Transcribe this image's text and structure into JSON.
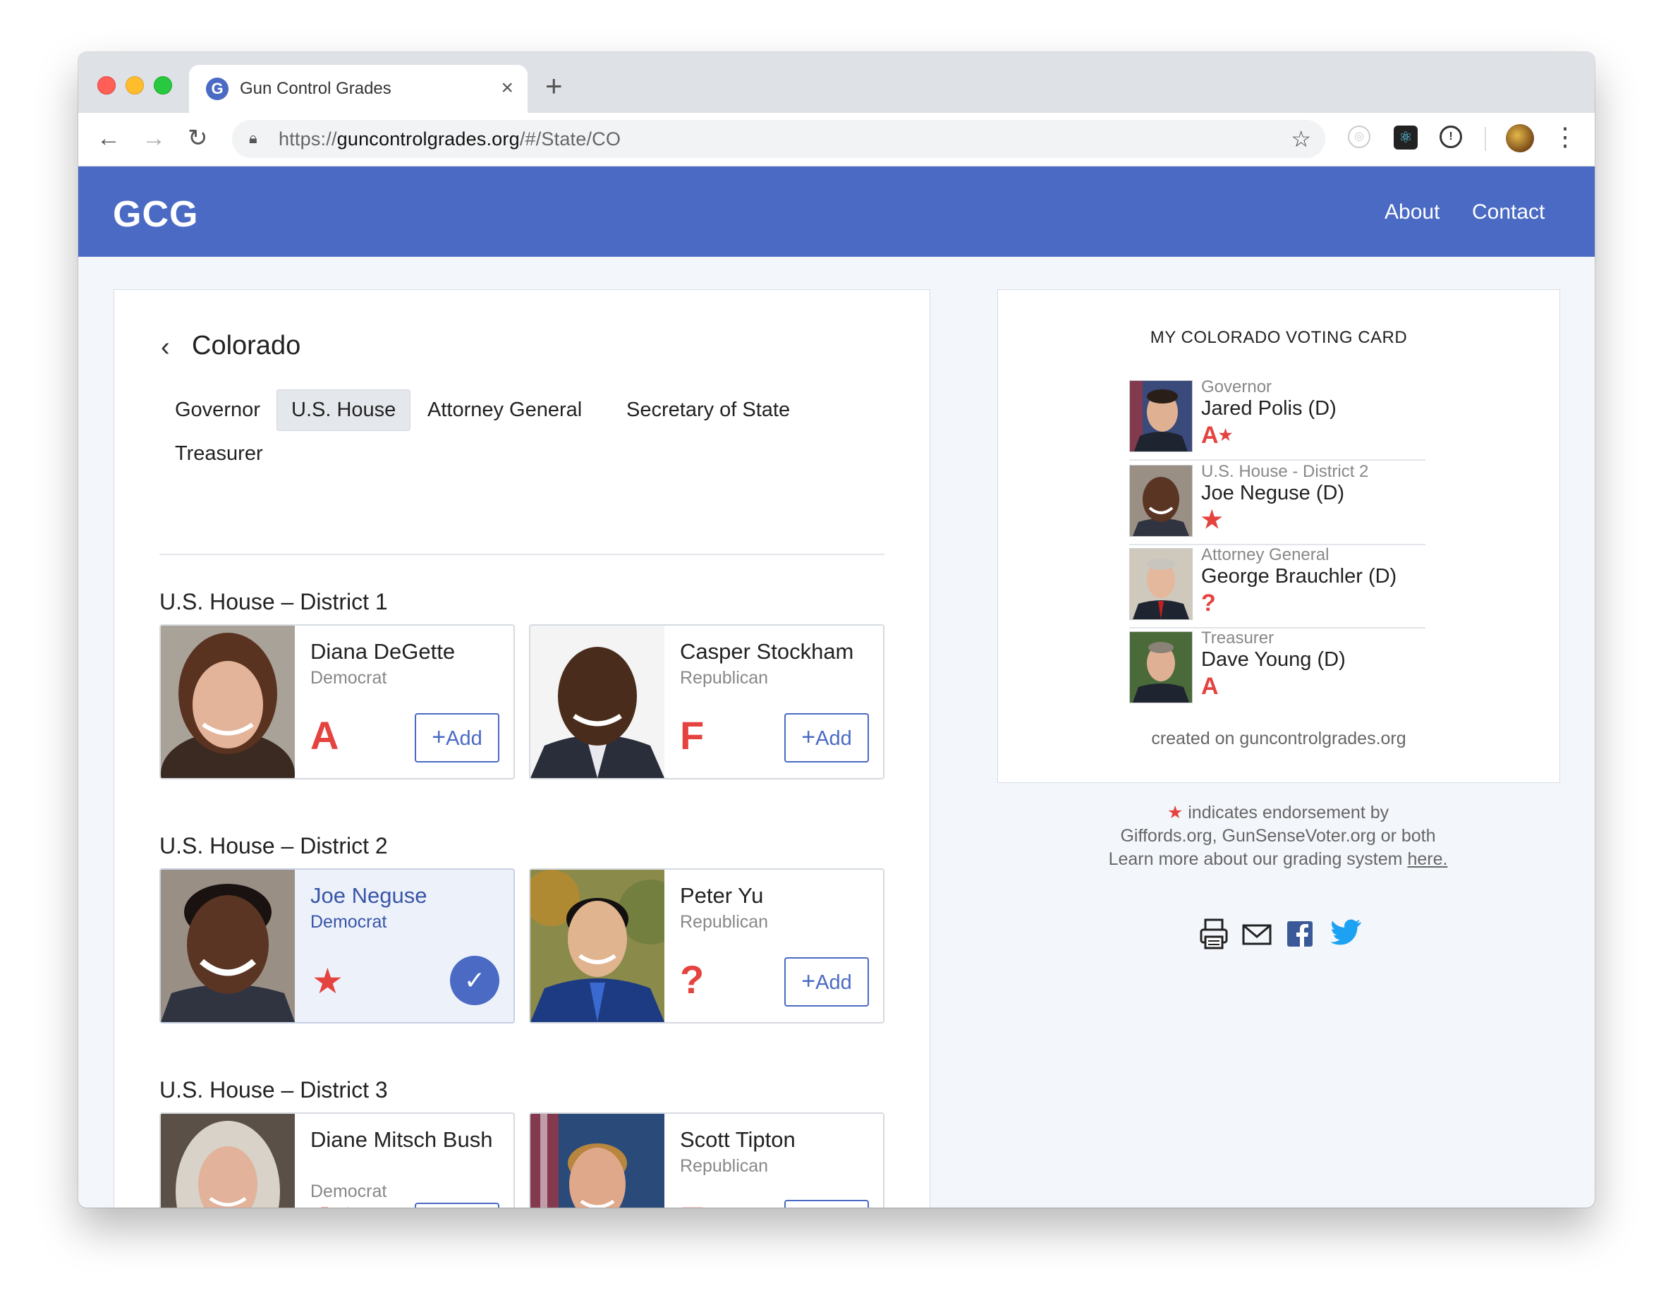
{
  "browser": {
    "tab_title": "Gun Control Grades",
    "tab_favicon": "G",
    "url_scheme": "https://",
    "url_host": "guncontrolgrades.org",
    "url_path": "/#/State/CO"
  },
  "site": {
    "logo": "GCG",
    "nav": {
      "about": "About",
      "contact": "Contact"
    },
    "brand_color": "#4a6ac4",
    "grade_color": "#e5433f"
  },
  "main": {
    "state": "Colorado",
    "office_tabs": [
      "Governor",
      "U.S. House",
      "Attorney General",
      "Secretary of State",
      "Treasurer"
    ],
    "active_tab": "U.S. House",
    "add_label": "Add",
    "districts": [
      {
        "title": "U.S. House – District 1",
        "candidates": [
          {
            "name": "Diana DeGette",
            "party": "Democrat",
            "grade": "A",
            "endorsed": false,
            "selected": false
          },
          {
            "name": "Casper Stockham",
            "party": "Republican",
            "grade": "F",
            "endorsed": false,
            "selected": false
          }
        ]
      },
      {
        "title": "U.S. House – District 2",
        "candidates": [
          {
            "name": "Joe Neguse",
            "party": "Democrat",
            "grade": "★",
            "endorsed": true,
            "selected": true
          },
          {
            "name": "Peter Yu",
            "party": "Republican",
            "grade": "?",
            "endorsed": false,
            "selected": false
          }
        ]
      },
      {
        "title": "U.S. House – District 3",
        "candidates": [
          {
            "name": "Diane Mitsch Bush",
            "party": "Democrat",
            "grade": "A",
            "endorsed": true,
            "selected": false
          },
          {
            "name": "Scott Tipton",
            "party": "Republican",
            "grade": "F",
            "endorsed": false,
            "selected": false
          }
        ]
      }
    ]
  },
  "voting_card": {
    "title": "MY COLORADO VOTING CARD",
    "rows": [
      {
        "office": "Governor",
        "name": "Jared Polis (D)",
        "grade": "A",
        "endorsed": true
      },
      {
        "office": "U.S. House - District 2",
        "name": "Joe Neguse (D)",
        "grade": "★",
        "endorsed": true
      },
      {
        "office": "Attorney General",
        "name": "George Brauchler (D)",
        "grade": "?",
        "endorsed": false
      },
      {
        "office": "Treasurer",
        "name": "Dave Young (D)",
        "grade": "A",
        "endorsed": false
      }
    ],
    "footer": "created on guncontrolgrades.org"
  },
  "legend": {
    "line1": "indicates endorsement by",
    "line2": "Giffords.org, GunSenseVoter.org or both",
    "line3": "Learn more about our grading system",
    "link": "here."
  },
  "share_icons": [
    "print-icon",
    "email-icon",
    "facebook-icon",
    "twitter-icon"
  ]
}
